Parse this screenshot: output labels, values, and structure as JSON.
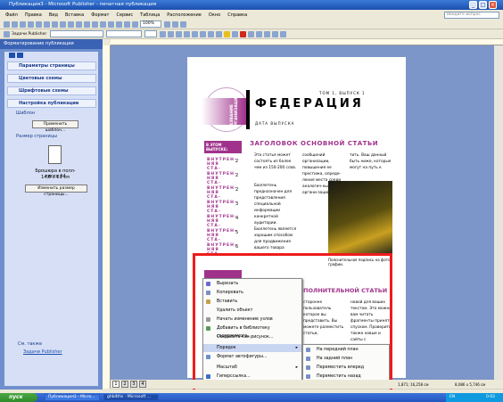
{
  "window": {
    "title": "Публикация3 - Microsoft Publisher - печатная публикация"
  },
  "menu": [
    "Файл",
    "Правка",
    "Вид",
    "Вставка",
    "Формат",
    "Сервис",
    "Таблица",
    "Расположение",
    "Окно",
    "Справка"
  ],
  "search": {
    "placeholder": "Введите вопрос"
  },
  "zoom": "100%",
  "taskpane_toolbar": "Задачи Publisher",
  "taskpane": {
    "title": "Форматирование публикации",
    "sections": [
      "Параметры страницы",
      "Цветовые схемы",
      "Шрифтовые схемы",
      "Настройка публикации"
    ],
    "template_label": "Шаблон",
    "template_button": "Применить шаблон...",
    "pagesize_label": "Размер страницы",
    "pagesize_text": "Брошюра в полл-листа А4",
    "pagesize_dims": "14,8 х 21 см",
    "change_button": "Изменить размер страницы...",
    "see_also": "См. также",
    "link": "Задачи Publisher"
  },
  "newsletter": {
    "masthead": "ФЕДЕРАЦИЯ",
    "vertical_title": "НАЗВАНИЕ ОРГАНИЗАЦИИ",
    "issue": "ТОМ 1, ВЫПУСК 1",
    "date": "ДАТА ВЫПУСКА",
    "in_issue": "В ЭТОМ ВЫПУСКЕ:",
    "toc_item": "ВНУТРЕН-НЯЯ СТА-",
    "toc_nums": [
      "2",
      "2",
      "2",
      "3",
      "4",
      "5",
      "6"
    ],
    "headline": "ЗАГОЛОВОК ОСНОВНОЙ СТАТЬИ",
    "headline2": "ПОЛНИТЕЛЬНОЙ СТАТЬИ",
    "col1a": "Эта статья может состоять из более чем из 150-200 слов.",
    "col1b": "Бюллетень предназначен для представления специальной информации конкретной аудитории. Бюллетень является хорошим способом для продвижения вашего товара",
    "col2a": "сообщений организации, повышения ее престижа, опреде-ления места среди аналогич-ных органи-заций.",
    "col2b": "Сначала определи-те, для какой аудито-рии предназ-начен бюл-",
    "col3a": "тить. Ваш данный быть ниже, которые могут на путь к",
    "caption": "Пояснительная подпись на фото графии.",
    "bottom_a": "сторонне\nпользователь которое вы представить. Вы можете разместить статьи,",
    "bottom_b": "новой для ваших текстом. Это можно вам читать фрагменты принять спуском. Проверить также новые и сайты с организации."
  },
  "context_menu": [
    "Вырезать",
    "Копировать",
    "Вставить",
    "Удалить объект",
    "Начать изменение узлов",
    "Добавить в библиотеку содержимого...",
    "Создавать как рисунок...",
    "Порядок",
    "Формат автофигуры...",
    "Масштаб",
    "Гиперссылка..."
  ],
  "submenu": [
    "На передний план",
    "На задний план",
    "Переместить вперед",
    "Переместить назад"
  ],
  "page_tabs": [
    "1",
    "2",
    "3",
    "4"
  ],
  "status": {
    "coords": "1,871; 16,258 см",
    "size": "8,086 x 5,746 см"
  },
  "taskbar": {
    "start": "пуск",
    "tasks": [
      "Публикация3 - Micro...",
      "ghb4ths - Microsoft ..."
    ],
    "lang": "EN",
    "clock": "0:02"
  },
  "colors": {
    "accent": "#a0328c",
    "red_frame": "#ee1c1c",
    "titlebar": "#1c4fb0"
  }
}
